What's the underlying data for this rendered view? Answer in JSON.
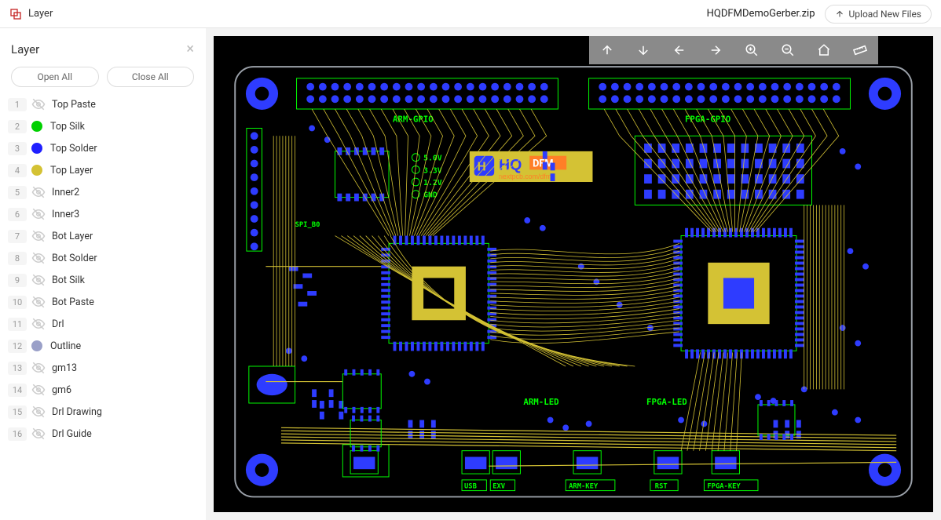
{
  "header": {
    "title": "Layer",
    "filename": "HQDFMDemoGerber.zip",
    "upload_label": "Upload New Files"
  },
  "panel": {
    "title": "Layer",
    "open_all": "Open All",
    "close_all": "Close All"
  },
  "layers": [
    {
      "n": "1",
      "name": "Top Paste",
      "color": null,
      "visible": false
    },
    {
      "n": "2",
      "name": "Top Silk",
      "color": "#00d000",
      "visible": true
    },
    {
      "n": "3",
      "name": "Top Solder",
      "color": "#2020ff",
      "visible": true
    },
    {
      "n": "4",
      "name": "Top Layer",
      "color": "#d4c234",
      "visible": true
    },
    {
      "n": "5",
      "name": "Inner2",
      "color": null,
      "visible": false
    },
    {
      "n": "6",
      "name": "Inner3",
      "color": null,
      "visible": false
    },
    {
      "n": "7",
      "name": "Bot Layer",
      "color": null,
      "visible": false
    },
    {
      "n": "8",
      "name": "Bot Solder",
      "color": null,
      "visible": false
    },
    {
      "n": "9",
      "name": "Bot Silk",
      "color": null,
      "visible": false
    },
    {
      "n": "10",
      "name": "Bot Paste",
      "color": null,
      "visible": false
    },
    {
      "n": "11",
      "name": "Drl",
      "color": null,
      "visible": false
    },
    {
      "n": "12",
      "name": "Outline",
      "color": "#9aa0c8",
      "visible": true
    },
    {
      "n": "13",
      "name": "gm13",
      "color": null,
      "visible": false
    },
    {
      "n": "14",
      "name": "gm6",
      "color": null,
      "visible": false
    },
    {
      "n": "15",
      "name": "Drl Drawing",
      "color": null,
      "visible": false
    },
    {
      "n": "16",
      "name": "Drl Guide",
      "color": null,
      "visible": false
    }
  ],
  "toolbar": {
    "tools": [
      "arrow-up",
      "arrow-down",
      "arrow-left",
      "arrow-right",
      "zoom-in",
      "zoom-out",
      "home",
      "ruler"
    ]
  },
  "pcb": {
    "silk_labels": {
      "arm_gpio": "ARM-GPIO",
      "fpga_gpio": "FPGA-GPIO",
      "v50": "5.0V",
      "v33": "3.3V",
      "v12": "1.2V",
      "gnd": "GND",
      "spi_b0": "SPI_B0",
      "arm_led": "ARM-LED",
      "fpga_led": "FPGA-LED",
      "usb": "USB",
      "exv": "EXV",
      "arm_key": "ARM-KEY",
      "rst": "RST",
      "fpga_key": "FPGA-KEY"
    },
    "logo": {
      "brand": "HQ",
      "suffix": "DFM",
      "url": "nextpcb.com/dfm"
    }
  }
}
